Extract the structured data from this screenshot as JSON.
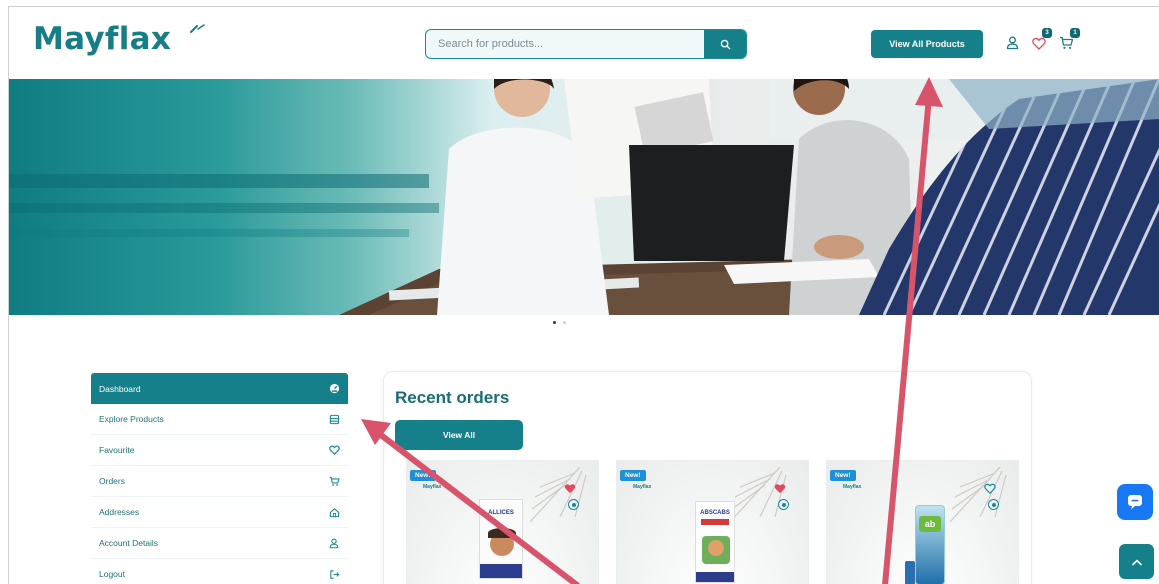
{
  "brand": {
    "name": "Mayflax"
  },
  "search": {
    "placeholder": "Search for products..."
  },
  "header": {
    "view_all_products_label": "View All Products",
    "wishlist_count": "3",
    "cart_count": "1"
  },
  "sidebar": {
    "items": [
      {
        "label": "Dashboard",
        "icon": "dashboard-icon"
      },
      {
        "label": "Explore Products",
        "icon": "store-icon"
      },
      {
        "label": "Favourite",
        "icon": "heart-icon"
      },
      {
        "label": "Orders",
        "icon": "cart-icon"
      },
      {
        "label": "Addresses",
        "icon": "home-icon"
      },
      {
        "label": "Account Details",
        "icon": "user-icon"
      },
      {
        "label": "Logout",
        "icon": "logout-icon"
      }
    ]
  },
  "recent_orders": {
    "title": "Recent orders",
    "view_all_label": "View All",
    "products": [
      {
        "badge": "New!",
        "brand": "Mayflax",
        "product_text": "ALLICES",
        "favorited": true
      },
      {
        "badge": "New!",
        "brand": "Mayflax",
        "product_text": "ABSCABS",
        "favorited": true
      },
      {
        "badge": "New!",
        "brand": "Mayflax",
        "product_text": "ab",
        "favorited": false
      }
    ]
  },
  "colors": {
    "primary": "#16808a",
    "heading": "#1a6d75",
    "badge_blue": "#1f8fd6",
    "heart_red": "#e3485f",
    "annotation_arrow": "#d8546b",
    "chat_blue": "#1877f2"
  },
  "carousel": {
    "slides": 2,
    "active": 1
  }
}
